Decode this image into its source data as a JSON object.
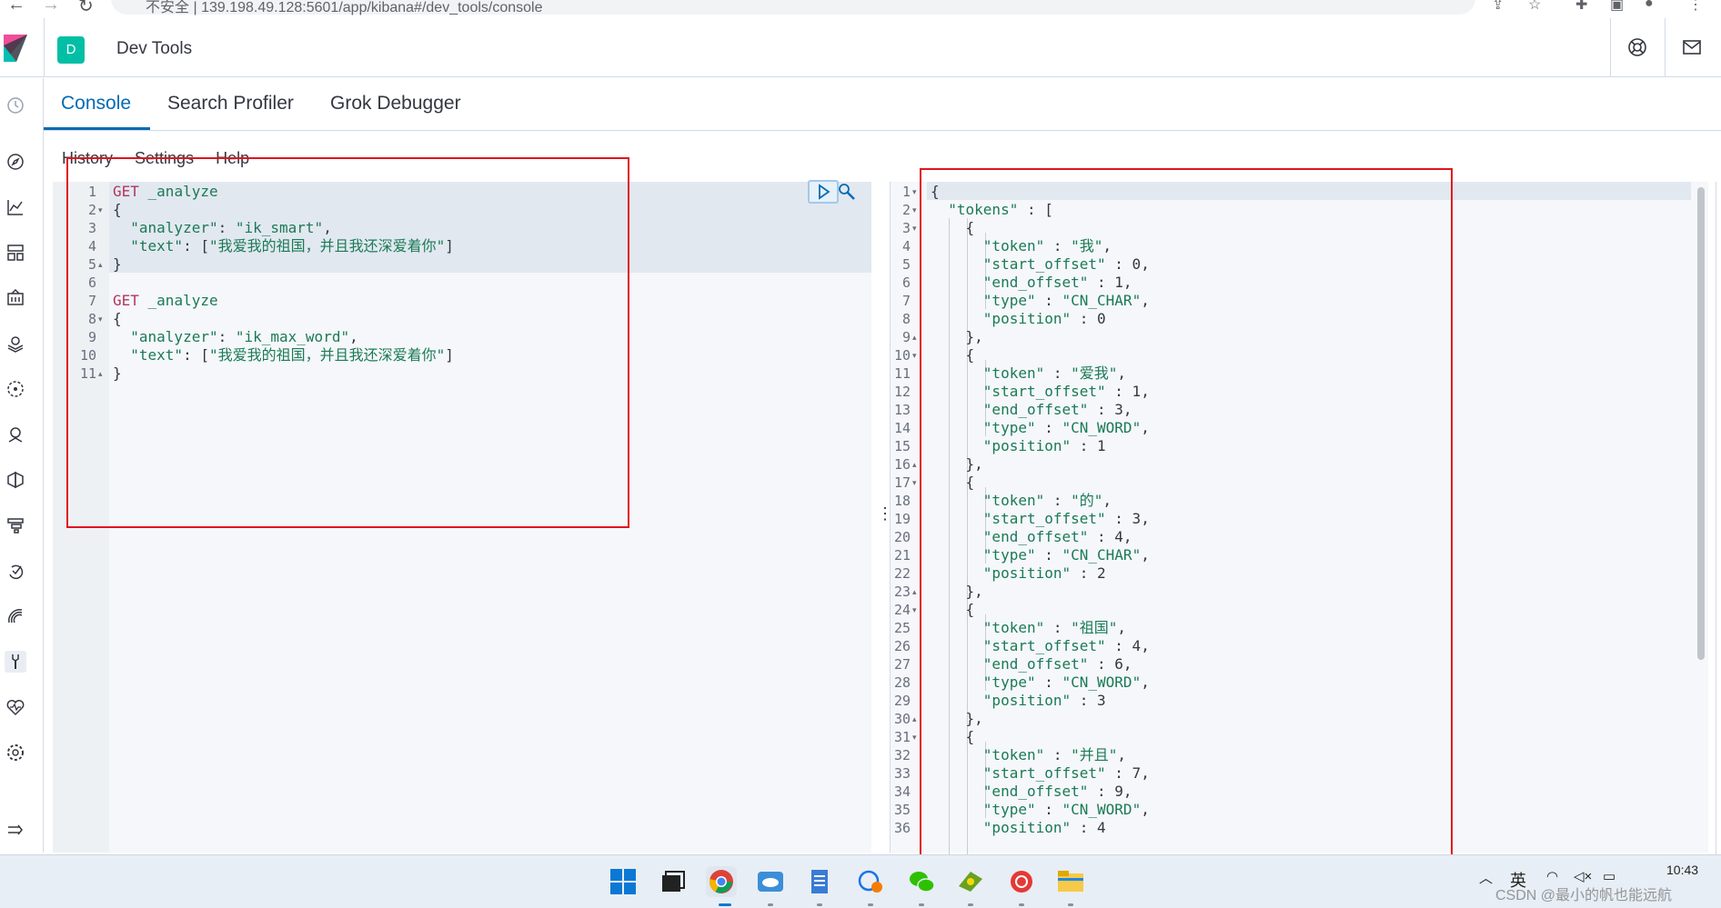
{
  "browser": {
    "url_prefix": "不安全 |",
    "url": "139.198.49.128:5601/app/kibana#/dev_tools/console"
  },
  "header": {
    "space_initial": "D",
    "title": "Dev Tools"
  },
  "tabs": [
    "Console",
    "Search Profiler",
    "Grok Debugger"
  ],
  "console_menu": [
    "History",
    "Settings",
    "Help"
  ],
  "request_editor": {
    "lines": [
      {
        "n": "1",
        "segs": [
          [
            "kw",
            "GET"
          ],
          [
            "str",
            " _analyze"
          ]
        ]
      },
      {
        "n": "2",
        "segs": [
          [
            "txt",
            "{"
          ]
        ]
      },
      {
        "n": "3",
        "segs": [
          [
            "txt",
            "  "
          ],
          [
            "str",
            "\"analyzer\""
          ],
          [
            "txt",
            ": "
          ],
          [
            "str",
            "\"ik_smart\""
          ],
          [
            "txt",
            ","
          ]
        ]
      },
      {
        "n": "4",
        "segs": [
          [
            "txt",
            "  "
          ],
          [
            "str",
            "\"text\""
          ],
          [
            "txt",
            ": ["
          ],
          [
            "str",
            "\"我爱我的祖国，并且我还深爱着你\""
          ],
          [
            "txt",
            "]"
          ]
        ]
      },
      {
        "n": "5",
        "segs": [
          [
            "txt",
            "}"
          ]
        ]
      },
      {
        "n": "6",
        "segs": []
      },
      {
        "n": "7",
        "segs": [
          [
            "kw",
            "GET"
          ],
          [
            "str",
            " _analyze"
          ]
        ]
      },
      {
        "n": "8",
        "segs": [
          [
            "txt",
            "{"
          ]
        ]
      },
      {
        "n": "9",
        "segs": [
          [
            "txt",
            "  "
          ],
          [
            "str",
            "\"analyzer\""
          ],
          [
            "txt",
            ": "
          ],
          [
            "str",
            "\"ik_max_word\""
          ],
          [
            "txt",
            ","
          ]
        ]
      },
      {
        "n": "10",
        "segs": [
          [
            "txt",
            "  "
          ],
          [
            "str",
            "\"text\""
          ],
          [
            "txt",
            ": ["
          ],
          [
            "str",
            "\"我爱我的祖国，并且我还深爱着你\""
          ],
          [
            "txt",
            "]"
          ]
        ]
      },
      {
        "n": "11",
        "segs": [
          [
            "txt",
            "}"
          ]
        ]
      }
    ]
  },
  "response_editor": {
    "lines": [
      {
        "n": "1",
        "t": "{"
      },
      {
        "n": "2",
        "t": "  \"tokens\" : ["
      },
      {
        "n": "3",
        "t": "    {"
      },
      {
        "n": "4",
        "t": "      \"token\" : \"我\","
      },
      {
        "n": "5",
        "t": "      \"start_offset\" : 0,"
      },
      {
        "n": "6",
        "t": "      \"end_offset\" : 1,"
      },
      {
        "n": "7",
        "t": "      \"type\" : \"CN_CHAR\","
      },
      {
        "n": "8",
        "t": "      \"position\" : 0"
      },
      {
        "n": "9",
        "t": "    },"
      },
      {
        "n": "10",
        "t": "    {"
      },
      {
        "n": "11",
        "t": "      \"token\" : \"爱我\","
      },
      {
        "n": "12",
        "t": "      \"start_offset\" : 1,"
      },
      {
        "n": "13",
        "t": "      \"end_offset\" : 3,"
      },
      {
        "n": "14",
        "t": "      \"type\" : \"CN_WORD\","
      },
      {
        "n": "15",
        "t": "      \"position\" : 1"
      },
      {
        "n": "16",
        "t": "    },"
      },
      {
        "n": "17",
        "t": "    {"
      },
      {
        "n": "18",
        "t": "      \"token\" : \"的\","
      },
      {
        "n": "19",
        "t": "      \"start_offset\" : 3,"
      },
      {
        "n": "20",
        "t": "      \"end_offset\" : 4,"
      },
      {
        "n": "21",
        "t": "      \"type\" : \"CN_CHAR\","
      },
      {
        "n": "22",
        "t": "      \"position\" : 2"
      },
      {
        "n": "23",
        "t": "    },"
      },
      {
        "n": "24",
        "t": "    {"
      },
      {
        "n": "25",
        "t": "      \"token\" : \"祖国\","
      },
      {
        "n": "26",
        "t": "      \"start_offset\" : 4,"
      },
      {
        "n": "27",
        "t": "      \"end_offset\" : 6,"
      },
      {
        "n": "28",
        "t": "      \"type\" : \"CN_WORD\","
      },
      {
        "n": "29",
        "t": "      \"position\" : 3"
      },
      {
        "n": "30",
        "t": "    },"
      },
      {
        "n": "31",
        "t": "    {"
      },
      {
        "n": "32",
        "t": "      \"token\" : \"并且\","
      },
      {
        "n": "33",
        "t": "      \"start_offset\" : 7,"
      },
      {
        "n": "34",
        "t": "      \"end_offset\" : 9,"
      },
      {
        "n": "35",
        "t": "      \"type\" : \"CN_WORD\","
      },
      {
        "n": "36",
        "t": "      \"position\" : 4"
      }
    ]
  },
  "taskbar": {
    "tray_lang": "英",
    "time": "10:43",
    "watermark": "CSDN @最小的帆也能远航"
  },
  "colors": {
    "accent": "#006bb4",
    "annotation": "#e0141e",
    "space_badge": "#00bfa5"
  }
}
